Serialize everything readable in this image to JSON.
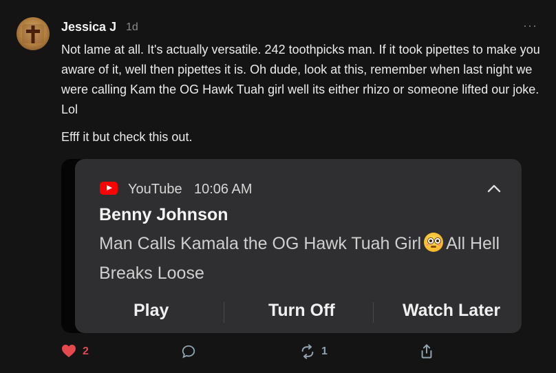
{
  "post": {
    "author": "Jessica J",
    "age": "1d",
    "more": "···",
    "paragraphs": [
      "Not lame at all. It's actually versatile. 242 toothpicks man. If it took pipettes to make you aware of it, well then pipettes it is. Oh dude, look at this, remember when last night we were calling Kam the OG Hawk Tuah girl well its either rhizo or someone lifted our joke. Lol",
      "Efff it but check this out."
    ]
  },
  "notification": {
    "app": "YouTube",
    "time": "10:06 AM",
    "title": "Benny Johnson",
    "message_before": "Man Calls Kamala the OG Hawk Tuah Girl",
    "emoji": "flushed-face",
    "message_after": "All Hell Breaks Loose",
    "actions": [
      "Play",
      "Turn Off",
      "Watch Later"
    ]
  },
  "stats": {
    "likes": "2",
    "restacks": "1"
  },
  "colors": {
    "background": "#141414",
    "card": "#2f2f31",
    "like": "#e5484d",
    "restack": "#8fa3b0",
    "youtube_red": "#ff0000"
  },
  "icons": [
    "heart-icon",
    "comment-icon",
    "restack-icon",
    "share-icon",
    "youtube-icon",
    "chevron-up-icon",
    "more-icon"
  ]
}
